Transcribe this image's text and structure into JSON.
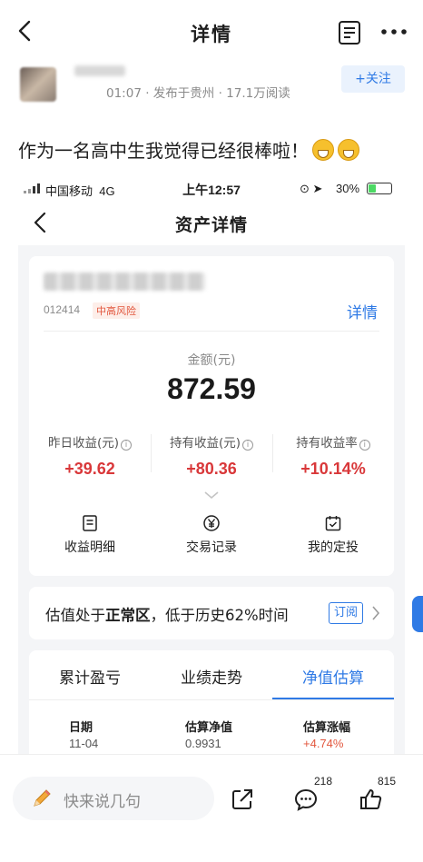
{
  "nav": {
    "title": "详情"
  },
  "author": {
    "meta": "01:07 · 发布于贵州 · 17.1万阅读",
    "follow_label": "+关注"
  },
  "post": {
    "text": "作为一名高中生我觉得已经很棒啦！"
  },
  "screenshot": {
    "status": {
      "carrier": "中国移动",
      "network": "4G",
      "time": "上午12:57",
      "battery": "30%"
    },
    "title": "资产详情",
    "fund": {
      "code": "012414",
      "risk": "中高风险",
      "detail_link": "详情"
    },
    "amount": {
      "label": "金额(元)",
      "value": "872.59"
    },
    "stats": [
      {
        "label": "昨日收益(元)",
        "value": "+39.62"
      },
      {
        "label": "持有收益(元)",
        "value": "+80.36"
      },
      {
        "label": "持有收益率",
        "value": "+10.14%"
      }
    ],
    "actions": [
      {
        "label": "收益明细",
        "icon": "receipt-icon"
      },
      {
        "label": "交易记录",
        "icon": "yen-icon"
      },
      {
        "label": "我的定投",
        "icon": "calendar-icon"
      }
    ],
    "valuation": {
      "prefix": "估值处于",
      "highlight": "正常区",
      "suffix": "，低于历史62%时间",
      "subscribe_label": "订阅"
    },
    "tabs": [
      {
        "label": "累计盈亏",
        "active": false
      },
      {
        "label": "业绩走势",
        "active": false
      },
      {
        "label": "净值估算",
        "active": true
      }
    ],
    "table": {
      "headers": [
        "日期",
        "估算净值",
        "估算涨幅"
      ],
      "row": [
        "11-04",
        "0.9931",
        "+4.74%"
      ]
    }
  },
  "bottom": {
    "input_placeholder": "快来说几句",
    "comment_count": "218",
    "like_count": "815"
  },
  "colors": {
    "accent": "#2f7ae5",
    "up": "#d9383a",
    "risk": "#e2573e"
  }
}
